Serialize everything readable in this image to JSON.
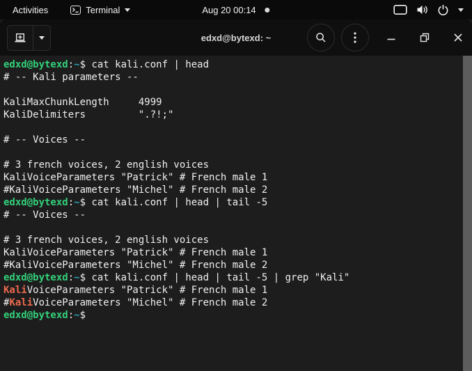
{
  "colors": {
    "topbar_bg": "#0a0a0a",
    "header_bg": "#0f0f0f",
    "terminal_bg": "#1d1d1d",
    "foreground": "#f0f0f0",
    "prompt_green": "#33d17a",
    "path_teal": "#2aa1b3",
    "grep_match_red": "#ed694d",
    "scrollbar_gray": "#5d5d5d"
  },
  "topbar": {
    "activities_label": "Activities",
    "app_menu": {
      "icon": "terminal-app-icon",
      "label": "Terminal"
    },
    "clock": "Aug 20 00:14",
    "notification_dot": "media-indicator-dot",
    "tray_icons": [
      "display-icon",
      "volume-icon",
      "power-icon",
      "chevron-down-icon"
    ]
  },
  "window": {
    "title": "edxd@bytexd: ~",
    "header_buttons": [
      "new-tab-button",
      "tab-chooser-button",
      "search-button",
      "menu-button",
      "minimize-button",
      "restore-button",
      "close-button"
    ]
  },
  "terminal": {
    "lines": [
      {
        "segments": [
          {
            "t": "edxd@bytexd",
            "c": "green"
          },
          {
            "t": ":",
            "c": "fg"
          },
          {
            "t": "~",
            "c": "teal"
          },
          {
            "t": "$ ",
            "c": "fg"
          },
          {
            "t": "cat kali.conf | head",
            "c": "fg"
          }
        ]
      },
      {
        "segments": [
          {
            "t": "# -- Kali parameters --",
            "c": "fg"
          }
        ]
      },
      {
        "segments": []
      },
      {
        "segments": [
          {
            "t": "KaliMaxChunkLength     4999",
            "c": "fg"
          }
        ]
      },
      {
        "segments": [
          {
            "t": "KaliDelimiters         \".?!;\"",
            "c": "fg"
          }
        ]
      },
      {
        "segments": []
      },
      {
        "segments": [
          {
            "t": "# -- Voices --",
            "c": "fg"
          }
        ]
      },
      {
        "segments": []
      },
      {
        "segments": [
          {
            "t": "# 3 french voices, 2 english voices",
            "c": "fg"
          }
        ]
      },
      {
        "segments": [
          {
            "t": "KaliVoiceParameters \"Patrick\" # French male 1",
            "c": "fg"
          }
        ]
      },
      {
        "segments": [
          {
            "t": "#KaliVoiceParameters \"Michel\" # French male 2",
            "c": "fg"
          }
        ]
      },
      {
        "segments": [
          {
            "t": "edxd@bytexd",
            "c": "green"
          },
          {
            "t": ":",
            "c": "fg"
          },
          {
            "t": "~",
            "c": "teal"
          },
          {
            "t": "$ ",
            "c": "fg"
          },
          {
            "t": "cat kali.conf | head | tail -5",
            "c": "fg"
          }
        ]
      },
      {
        "segments": [
          {
            "t": "# -- Voices --",
            "c": "fg"
          }
        ]
      },
      {
        "segments": []
      },
      {
        "segments": [
          {
            "t": "# 3 french voices, 2 english voices",
            "c": "fg"
          }
        ]
      },
      {
        "segments": [
          {
            "t": "KaliVoiceParameters \"Patrick\" # French male 1",
            "c": "fg"
          }
        ]
      },
      {
        "segments": [
          {
            "t": "#KaliVoiceParameters \"Michel\" # French male 2",
            "c": "fg"
          }
        ]
      },
      {
        "segments": [
          {
            "t": "edxd@bytexd",
            "c": "green"
          },
          {
            "t": ":",
            "c": "fg"
          },
          {
            "t": "~",
            "c": "teal"
          },
          {
            "t": "$ ",
            "c": "fg"
          },
          {
            "t": "cat kali.conf | head | tail -5 | grep \"Kali\"",
            "c": "fg"
          }
        ]
      },
      {
        "segments": [
          {
            "t": "Kali",
            "c": "red"
          },
          {
            "t": "VoiceParameters \"Patrick\" # French male 1",
            "c": "fg"
          }
        ]
      },
      {
        "segments": [
          {
            "t": "#",
            "c": "fg"
          },
          {
            "t": "Kali",
            "c": "red"
          },
          {
            "t": "VoiceParameters \"Michel\" # French male 2",
            "c": "fg"
          }
        ]
      },
      {
        "segments": [
          {
            "t": "edxd@bytexd",
            "c": "green"
          },
          {
            "t": ":",
            "c": "fg"
          },
          {
            "t": "~",
            "c": "teal"
          },
          {
            "t": "$",
            "c": "fg"
          }
        ]
      }
    ]
  }
}
